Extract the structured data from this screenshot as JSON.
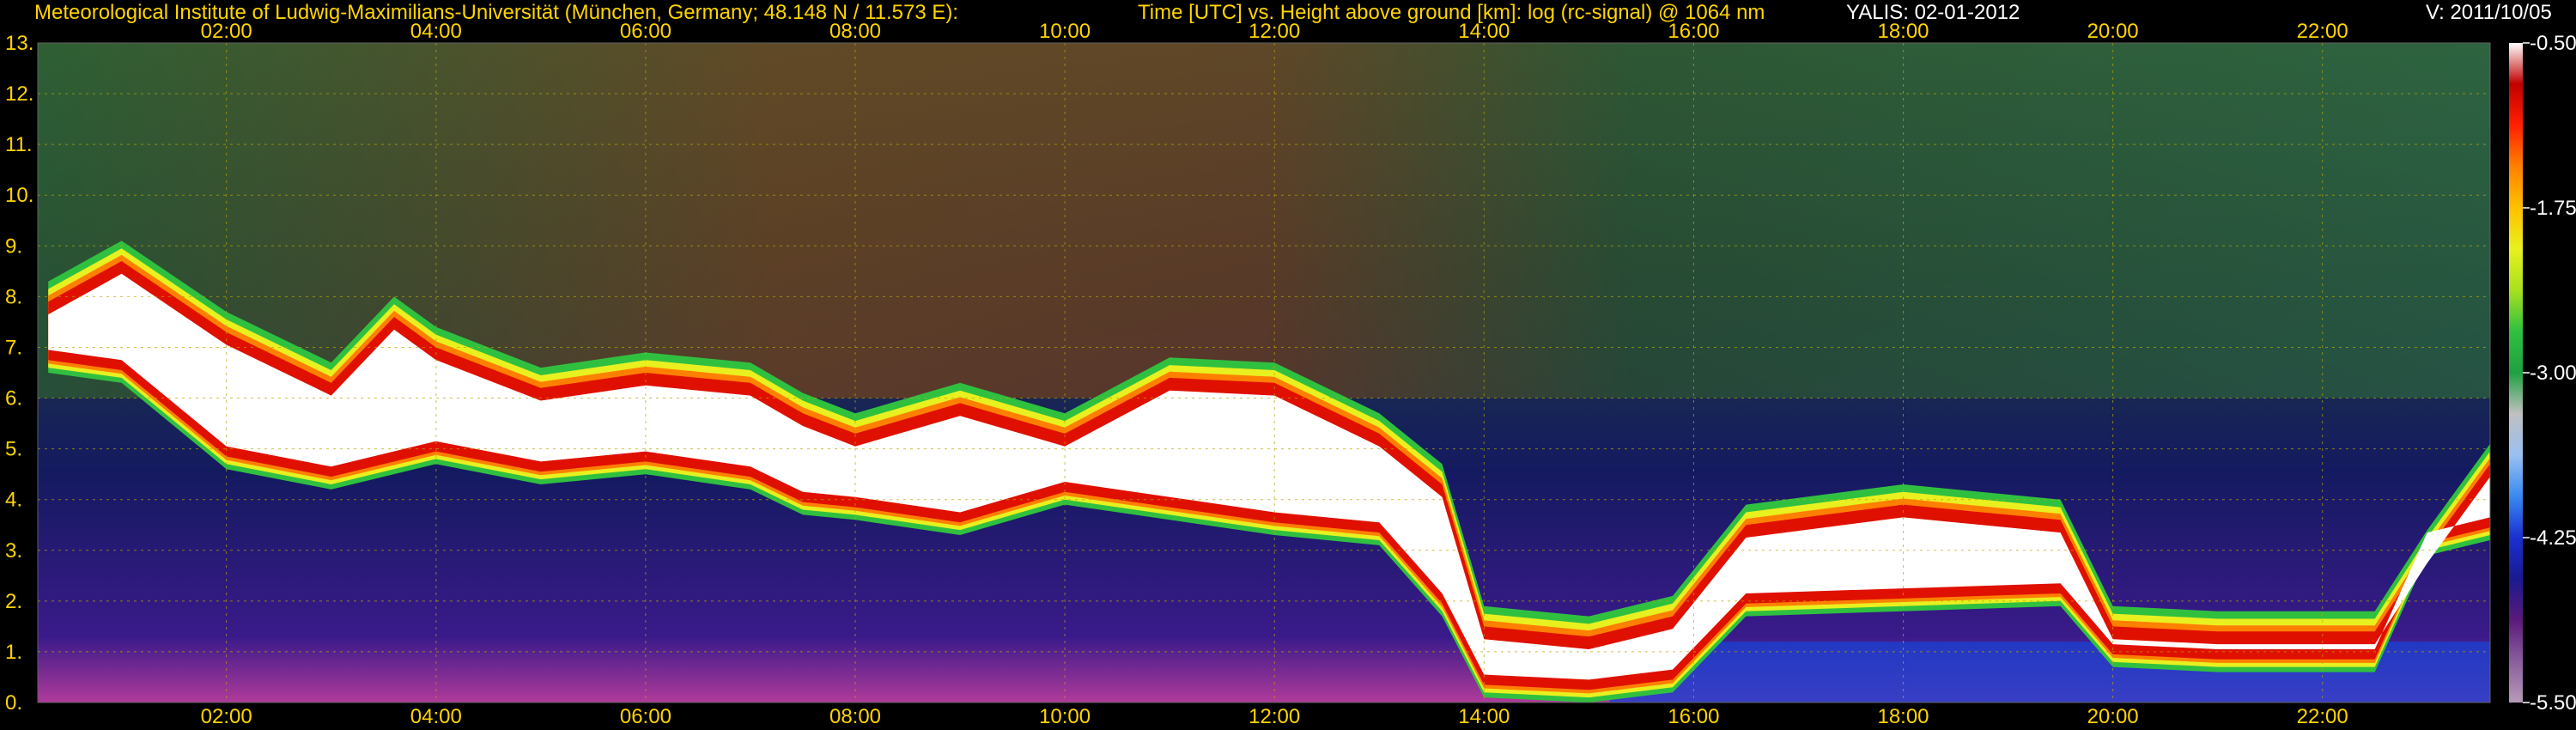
{
  "header": {
    "institute": "Meteorological Institute of Ludwig-Maximilians-Universität (München, Germany; 48.148 N / 11.573 E):",
    "description": "Time [UTC] vs. Height above ground [km]: log (rc-signal) @ 1064 nm",
    "instrument_date": "YALIS: 02-01-2012",
    "version": "V: 2011/10/05"
  },
  "colors": {
    "background": "#000000",
    "label_yellow": "#ffd400",
    "grid": "#b8a800",
    "label_white": "#ffffff"
  },
  "chart_data": {
    "type": "heatmap",
    "title": "Time [UTC] vs. Height above ground [km]: log (rc-signal) @ 1064 nm",
    "xlabel": "Time [UTC]",
    "ylabel": "Height above ground [km]",
    "x_ticks": [
      "02:00",
      "04:00",
      "06:00",
      "08:00",
      "10:00",
      "12:00",
      "14:00",
      "16:00",
      "18:00",
      "20:00",
      "22:00"
    ],
    "x_tick_hours": [
      2,
      4,
      6,
      8,
      10,
      12,
      14,
      16,
      18,
      20,
      22
    ],
    "xlim_hours": [
      0.2,
      23.6
    ],
    "y_ticks": [
      "0.",
      "1.",
      "2.",
      "3.",
      "4.",
      "5.",
      "6.",
      "7.",
      "8.",
      "9.",
      "10.",
      "11.",
      "12.",
      "13."
    ],
    "ylim": [
      0,
      13
    ],
    "grid": true,
    "colorbar": {
      "label": "log (rc-signal)",
      "ticks": [
        "-0.50",
        "-1.75",
        "-3.00",
        "-4.25",
        "-5.50"
      ],
      "tick_values": [
        -0.5,
        -1.75,
        -3.0,
        -4.25,
        -5.5
      ],
      "range": [
        -5.5,
        -0.5
      ],
      "colors_low_to_high": [
        "#b79ab8",
        "#8a5d9c",
        "#5a1a7a",
        "#1a1a90",
        "#1a30d0",
        "#3a8af0",
        "#9ac0f0",
        "#c0c0c0",
        "#20a040",
        "#30c040",
        "#a8e020",
        "#e8f020",
        "#ffc000",
        "#ff8000",
        "#ff2000",
        "#c00000",
        "#ffffff"
      ]
    },
    "cloud_top_km": [
      [
        0.3,
        7.8
      ],
      [
        1.0,
        8.6
      ],
      [
        2.0,
        7.2
      ],
      [
        3.0,
        6.2
      ],
      [
        3.6,
        7.5
      ],
      [
        4.0,
        6.9
      ],
      [
        5.0,
        6.1
      ],
      [
        6.0,
        6.4
      ],
      [
        7.0,
        6.2
      ],
      [
        7.5,
        5.6
      ],
      [
        8.0,
        5.2
      ],
      [
        9.0,
        5.8
      ],
      [
        10.0,
        5.2
      ],
      [
        11.0,
        6.3
      ],
      [
        12.0,
        6.2
      ],
      [
        13.0,
        5.2
      ],
      [
        13.6,
        4.2
      ],
      [
        14.0,
        1.4
      ],
      [
        15.0,
        1.2
      ],
      [
        15.8,
        1.6
      ],
      [
        16.5,
        3.4
      ],
      [
        18.0,
        3.8
      ],
      [
        19.5,
        3.5
      ],
      [
        20.0,
        1.4
      ],
      [
        21.0,
        1.3
      ],
      [
        22.5,
        1.3
      ],
      [
        23.0,
        2.9
      ],
      [
        23.6,
        4.6
      ]
    ],
    "cloud_base_km": [
      [
        0.3,
        6.8
      ],
      [
        1.0,
        6.6
      ],
      [
        2.0,
        4.9
      ],
      [
        3.0,
        4.5
      ],
      [
        4.0,
        5.0
      ],
      [
        5.0,
        4.6
      ],
      [
        6.0,
        4.8
      ],
      [
        7.0,
        4.5
      ],
      [
        7.5,
        4.0
      ],
      [
        8.0,
        3.9
      ],
      [
        9.0,
        3.6
      ],
      [
        10.0,
        4.2
      ],
      [
        11.0,
        3.9
      ],
      [
        12.0,
        3.6
      ],
      [
        13.0,
        3.4
      ],
      [
        13.6,
        2.0
      ],
      [
        14.0,
        0.4
      ],
      [
        15.0,
        0.3
      ],
      [
        15.8,
        0.5
      ],
      [
        16.5,
        2.0
      ],
      [
        18.0,
        2.1
      ],
      [
        19.5,
        2.2
      ],
      [
        20.0,
        1.0
      ],
      [
        21.0,
        0.9
      ],
      [
        22.5,
        0.9
      ],
      [
        23.0,
        3.2
      ],
      [
        23.6,
        3.5
      ]
    ]
  }
}
